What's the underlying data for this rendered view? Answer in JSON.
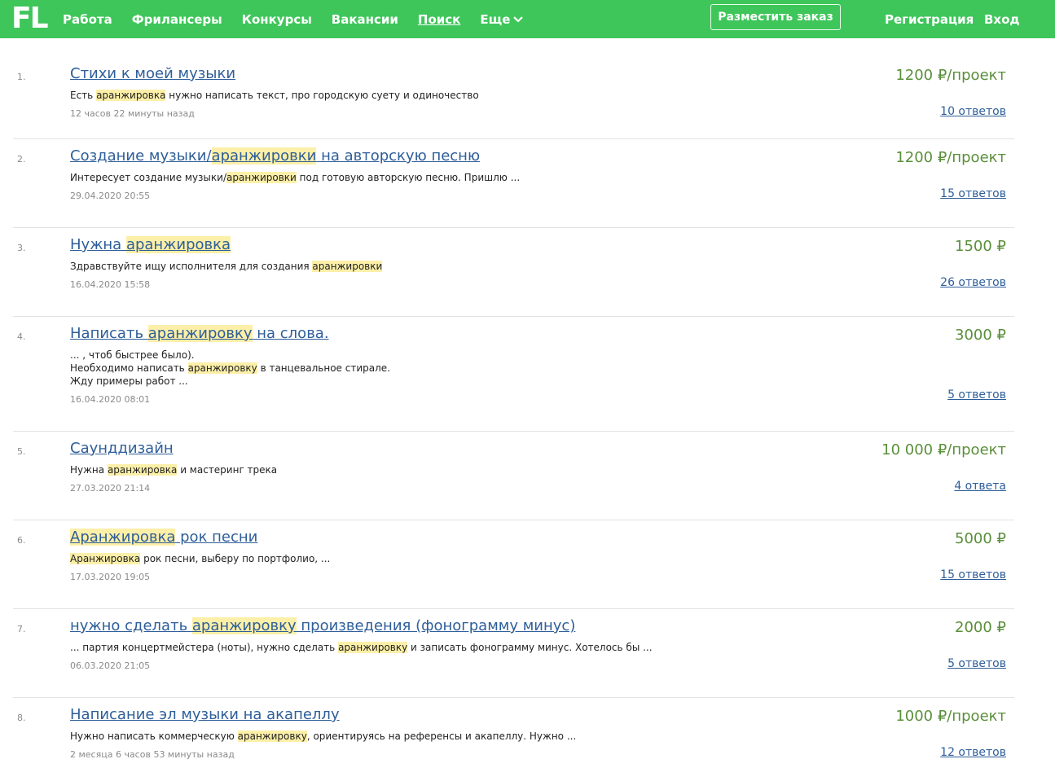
{
  "header": {
    "logo": "FL",
    "nav": [
      {
        "label": "Работа"
      },
      {
        "label": "Фрилансеры"
      },
      {
        "label": "Конкурсы"
      },
      {
        "label": "Вакансии"
      },
      {
        "label": "Поиск"
      },
      {
        "label": "Еще"
      }
    ],
    "post_button": "Разместить заказ",
    "register": "Регистрация",
    "login": "Вход"
  },
  "colors": {
    "topbar": "#3ec65a",
    "link": "#2e5e99",
    "price": "#5a8f3a",
    "highlight": "#fcefa8"
  },
  "results": [
    {
      "index": "1.",
      "title": [
        {
          "t": "Стихи к моей музыки"
        }
      ],
      "desc": [
        [
          {
            "t": "Есть "
          },
          {
            "t": "аранжировка",
            "h": true
          },
          {
            "t": " нужно написать текст, про городскую суету и одиночество"
          }
        ]
      ],
      "date": "12 часов 22 минуты назад",
      "price": "1200 ₽/проект",
      "answers": "10 ответов"
    },
    {
      "index": "2.",
      "title": [
        {
          "t": "Создание музыки/"
        },
        {
          "t": "аранжировки",
          "h": true
        },
        {
          "t": " на авторскую песню"
        }
      ],
      "desc": [
        [
          {
            "t": "Интересует создание музыки/"
          },
          {
            "t": "аранжировки",
            "h": true
          },
          {
            "t": " под готовую авторскую песню. Пришлю ..."
          }
        ]
      ],
      "date": "29.04.2020 20:55",
      "price": "1200 ₽/проект",
      "answers": "15 ответов"
    },
    {
      "index": "3.",
      "title": [
        {
          "t": "Нужна "
        },
        {
          "t": "аранжировка",
          "h": true
        }
      ],
      "desc": [
        [
          {
            "t": "Здравствуйте ищу исполнителя для создания "
          },
          {
            "t": "аранжировки",
            "h": true
          }
        ]
      ],
      "date": "16.04.2020 15:58",
      "price": "1500 ₽",
      "answers": "26 ответов"
    },
    {
      "index": "4.",
      "title": [
        {
          "t": "Написать "
        },
        {
          "t": "аранжировку",
          "h": true
        },
        {
          "t": " на слова."
        }
      ],
      "desc": [
        [
          {
            "t": "... , чтоб быстрее было)."
          }
        ],
        [
          {
            "t": "Необходимо написать "
          },
          {
            "t": "аранжировку",
            "h": true
          },
          {
            "t": " в танцевальное стирале."
          }
        ],
        [
          {
            "t": "Жду примеры работ ..."
          }
        ]
      ],
      "date": "16.04.2020 08:01",
      "price": "3000 ₽",
      "answers": "5 ответов"
    },
    {
      "index": "5.",
      "title": [
        {
          "t": "Саунддизайн"
        }
      ],
      "desc": [
        [
          {
            "t": "Нужна "
          },
          {
            "t": "аранжировка",
            "h": true
          },
          {
            "t": " и мастеринг трека"
          }
        ]
      ],
      "date": "27.03.2020 21:14",
      "price": "10 000 ₽/проект",
      "answers": "4 ответа"
    },
    {
      "index": "6.",
      "title": [
        {
          "t": "Аранжировка",
          "h": true
        },
        {
          "t": " рок песни"
        }
      ],
      "desc": [
        [
          {
            "t": "Аранжировка",
            "h": true
          },
          {
            "t": " рок песни, выберу по портфолио, ..."
          }
        ]
      ],
      "date": "17.03.2020 19:05",
      "price": "5000 ₽",
      "answers": "15 ответов"
    },
    {
      "index": "7.",
      "title": [
        {
          "t": "нужно сделать "
        },
        {
          "t": "аранжировку",
          "h": true
        },
        {
          "t": " произведения (фонограмму минус)"
        }
      ],
      "desc": [
        [
          {
            "t": "... партия концертмейстера (ноты), нужно сделать "
          },
          {
            "t": "аранжировку",
            "h": true
          },
          {
            "t": " и записать фонограмму минус. Хотелось бы ..."
          }
        ]
      ],
      "date": "06.03.2020 21:05",
      "price": "2000 ₽",
      "answers": "5 ответов"
    },
    {
      "index": "8.",
      "title": [
        {
          "t": "Написание эл музыки на акапеллу"
        }
      ],
      "desc": [
        [
          {
            "t": "Нужно написать коммерческую "
          },
          {
            "t": "аранжировку",
            "h": true
          },
          {
            "t": ", ориентируясь на референсы и акапеллу. Нужно ..."
          }
        ]
      ],
      "date": "2 месяца 6 часов 53 минуты назад",
      "price": "1000 ₽/проект",
      "answers": "12 ответов"
    }
  ]
}
